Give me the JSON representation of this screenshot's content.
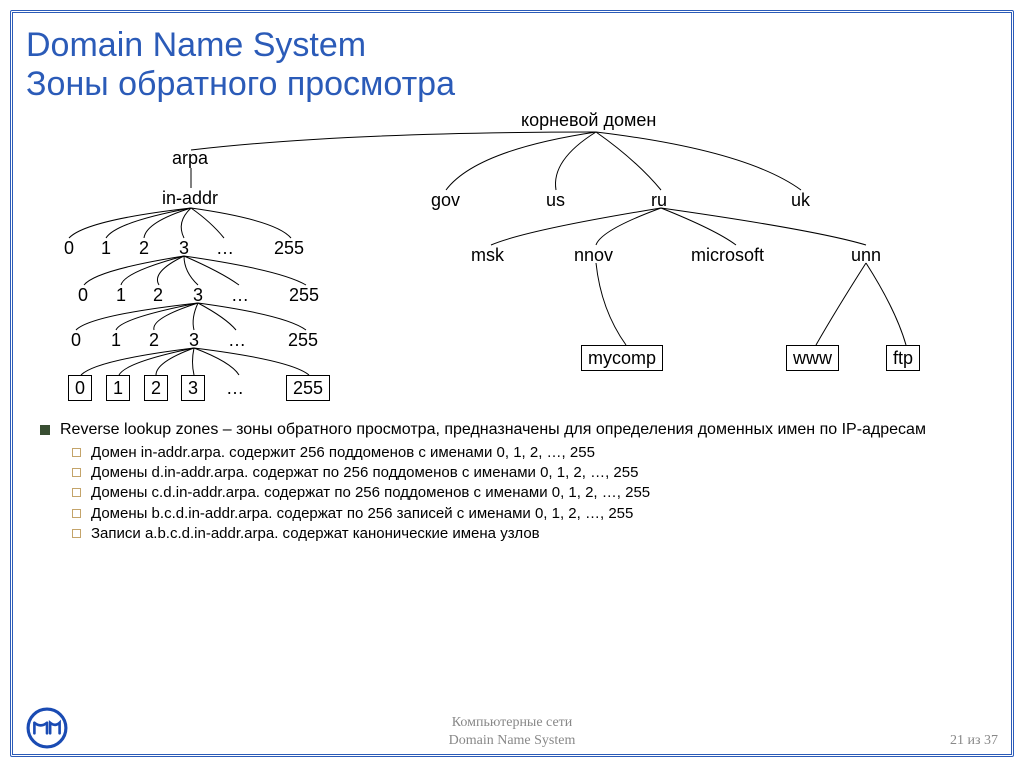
{
  "title_line1": "Domain Name System",
  "title_line2": "Зоны обратного просмотра",
  "tree": {
    "root": "корневой домен",
    "arpa": "arpa",
    "inaddr": "in-addr",
    "octets": [
      "0",
      "1",
      "2",
      "3",
      "…",
      "255"
    ],
    "tlds": [
      "gov",
      "us",
      "ru",
      "uk"
    ],
    "ru_subs": [
      "msk",
      "nnov",
      "microsoft",
      "unn"
    ],
    "leaves": [
      "mycomp",
      "www",
      "ftp"
    ]
  },
  "bullets": {
    "main": "Reverse lookup zones – зоны обратного просмотра, предназначены для определения доменных имен по IP-адресам",
    "subs": [
      "Домен in-addr.arpa. содержит 256 поддоменов с именами 0, 1, 2, …, 255",
      "Домены d.in-addr.arpa. содержат по 256 поддоменов с именами 0, 1, 2, …, 255",
      "Домены c.d.in-addr.arpa. содержат по 256 поддоменов с именами 0, 1, 2, …, 255",
      "Домены b.c.d.in-addr.arpa. содержат по 256 записей с именами 0, 1, 2, …, 255",
      "Записи a.b.c.d.in-addr.arpa. содержат канонические имена узлов"
    ]
  },
  "footer": {
    "center1": "Компьютерные сети",
    "center2": "Domain Name System",
    "right": "21 из 37"
  }
}
